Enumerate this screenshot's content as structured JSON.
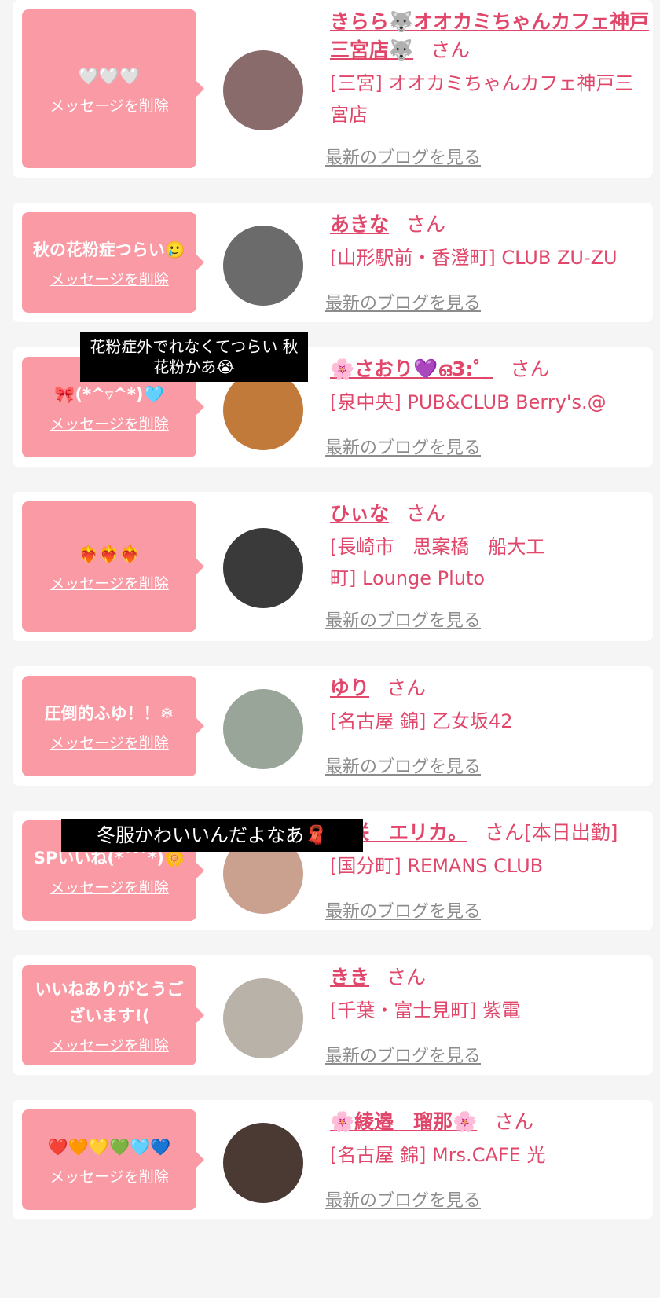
{
  "delete_label": "メッセージを削除",
  "blog_label": "最新のブログを見る",
  "honorific": "さん",
  "cards": [
    {
      "message": "🤍🤍🤍",
      "name": "きらら🐺オオカミちゃんカフェ神戸三宮店🐺",
      "extra": "",
      "shop": "[三宮] オオカミちゃんカフェ神戸三宮店",
      "avatar_color": "#8a6b6b"
    },
    {
      "message": "秋の花粉症つらい🥲",
      "name": "あきな",
      "extra": "",
      "shop": "[山形駅前・香澄町] CLUB ZU-ZU",
      "avatar_color": "#6b6b6b"
    },
    {
      "message": "🎀(*^▿^*)🩵",
      "name": "🌸さおり💜ഒ3:゜",
      "extra": "",
      "shop": "[泉中央] PUB&CLUB Berry's.@",
      "avatar_color": "#c27a3a"
    },
    {
      "message": "❤️‍🔥❤️‍🔥❤️‍🔥",
      "name": "ひぃな",
      "extra": "",
      "shop": "[長崎市　思案橋　船大工町] Lounge Pluto",
      "avatar_color": "#3a3a3a"
    },
    {
      "message": "圧倒的ふゆ！！❄",
      "name": "ゆり",
      "extra": "",
      "shop": "[名古屋 錦] 乙女坂42",
      "avatar_color": "#9aa59a"
    },
    {
      "message": "SPいいね(*´˘`*)🌼",
      "name": "白咲　エリカ。",
      "extra": "[本日出勤]",
      "shop": "[国分町] REMANS CLUB",
      "avatar_color": "#caa08f"
    },
    {
      "message": "いいねありがとうございます!(",
      "name": "きき",
      "extra": "",
      "shop": "[千葉・富士見町] 紫電",
      "avatar_color": "#b8b2a8"
    },
    {
      "message": "❤️🧡💛💚🩵💙",
      "name": "🌸綾邉　瑠那🌸",
      "extra": "",
      "shop": "[名古屋 錦] Mrs.CAFE 光",
      "avatar_color": "#4a3a33"
    }
  ],
  "overlays": [
    {
      "text": "花粉症外でれなくてつらい 秋花粉かあ😭"
    },
    {
      "text": "冬服かわいいんだよなあ🧣"
    }
  ]
}
